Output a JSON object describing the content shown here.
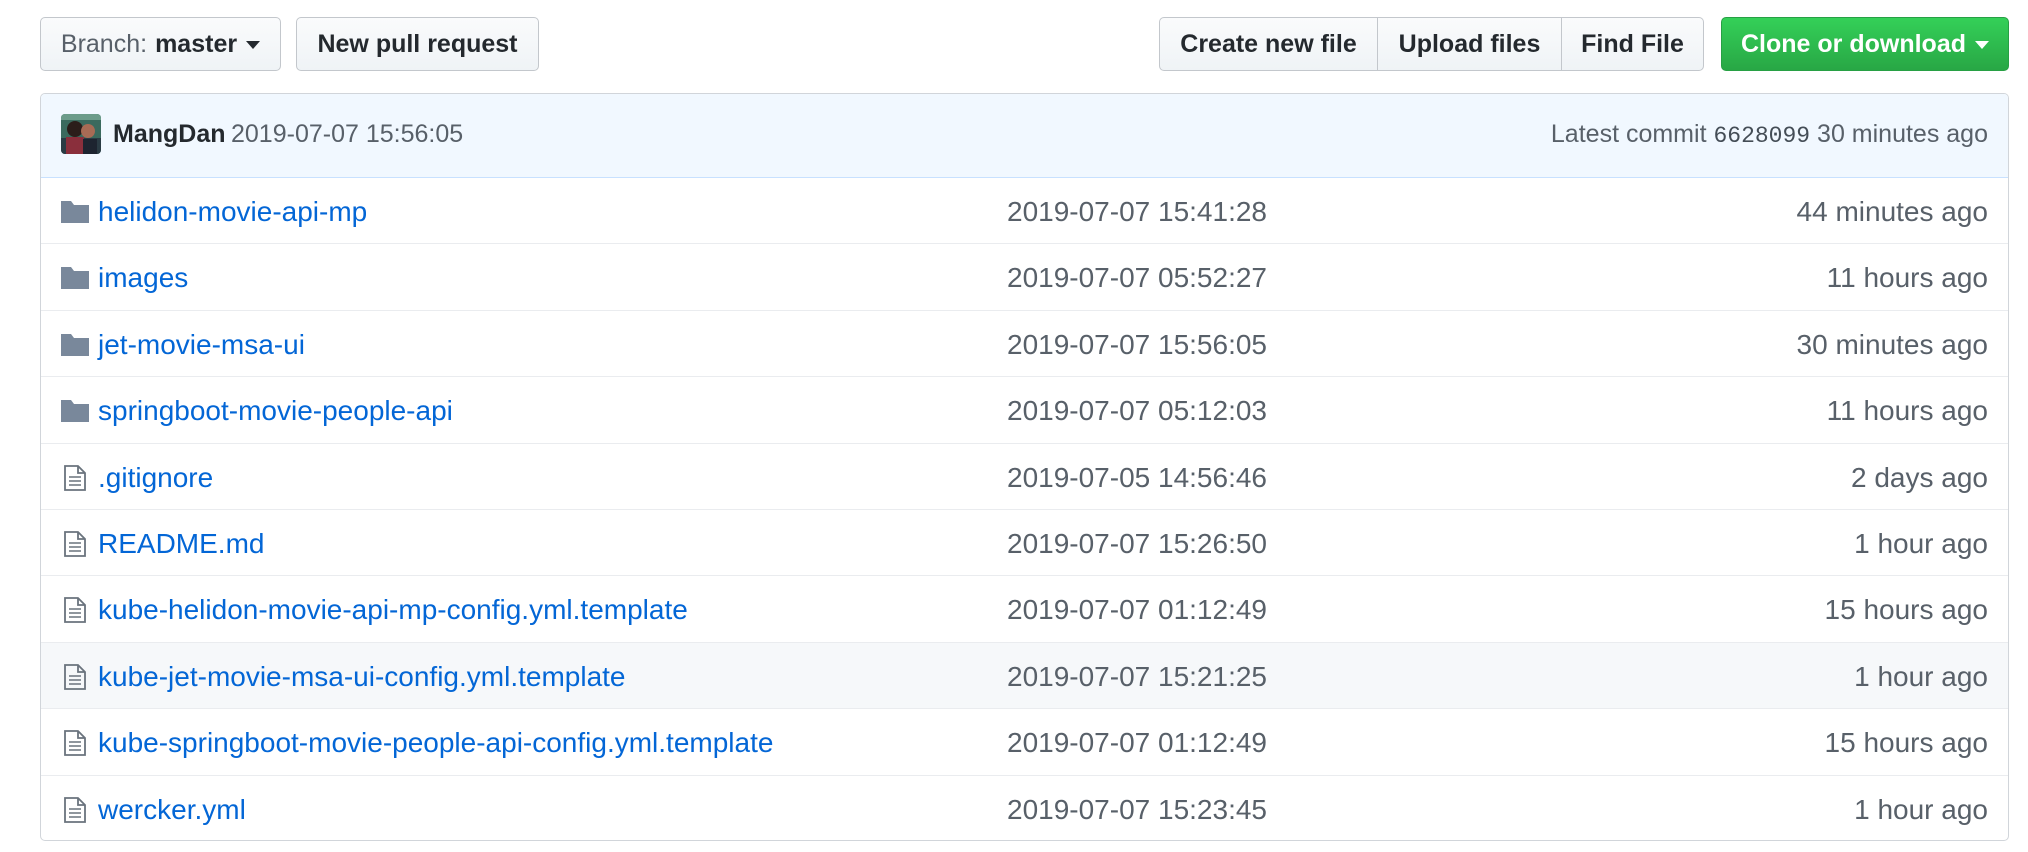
{
  "toolbar": {
    "branch_prefix": "Branch:",
    "branch_name": "master",
    "new_pull_request": "New pull request",
    "create_new_file": "Create new file",
    "upload_files": "Upload files",
    "find_file": "Find File",
    "clone_or_download": "Clone or download"
  },
  "commit": {
    "author": "MangDan",
    "message": "2019-07-07 15:56:05",
    "latest_label": "Latest commit",
    "sha": "6628099",
    "age": "30 minutes ago"
  },
  "files": [
    {
      "type": "folder",
      "icon": "folder-icon",
      "name": "helidon-movie-api-mp",
      "message": "2019-07-07 15:41:28",
      "age": "44 minutes ago"
    },
    {
      "type": "folder",
      "icon": "folder-icon",
      "name": "images",
      "message": "2019-07-07 05:52:27",
      "age": "11 hours ago"
    },
    {
      "type": "folder",
      "icon": "folder-icon",
      "name": "jet-movie-msa-ui",
      "message": "2019-07-07 15:56:05",
      "age": "30 minutes ago"
    },
    {
      "type": "folder",
      "icon": "folder-icon",
      "name": "springboot-movie-people-api",
      "message": "2019-07-07 05:12:03",
      "age": "11 hours ago"
    },
    {
      "type": "file",
      "icon": "file-icon",
      "name": ".gitignore",
      "message": "2019-07-05 14:56:46",
      "age": "2 days ago"
    },
    {
      "type": "file",
      "icon": "file-icon",
      "name": "README.md",
      "message": "2019-07-07 15:26:50",
      "age": "1 hour ago"
    },
    {
      "type": "file",
      "icon": "file-icon",
      "name": "kube-helidon-movie-api-mp-config.yml.template",
      "message": "2019-07-07 01:12:49",
      "age": "15 hours ago"
    },
    {
      "type": "file",
      "icon": "file-icon",
      "name": "kube-jet-movie-msa-ui-config.yml.template",
      "message": "2019-07-07 15:21:25",
      "age": "1 hour ago"
    },
    {
      "type": "file",
      "icon": "file-icon",
      "name": "kube-springboot-movie-people-api-config.yml.template",
      "message": "2019-07-07 01:12:49",
      "age": "15 hours ago"
    },
    {
      "type": "file",
      "icon": "file-icon",
      "name": "wercker.yml",
      "message": "2019-07-07 15:23:45",
      "age": "1 hour ago"
    }
  ],
  "colors": {
    "link": "#0366d6",
    "muted": "#586069",
    "primary_green": "#2ea44f",
    "commit_bar_bg": "#f1f8ff",
    "folder_icon": "#79889b",
    "file_icon": "#6a737d"
  }
}
